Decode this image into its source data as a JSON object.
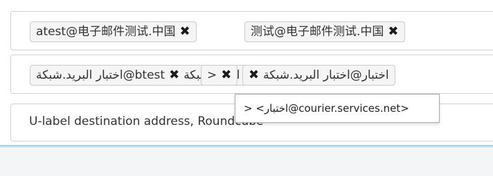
{
  "to_field": {
    "chips": [
      {
        "label": "atest@电子邮件测试.中国",
        "remove": "✖"
      },
      {
        "label": "测试@电子邮件测试.中国",
        "remove": "✖"
      }
    ]
  },
  "cc_field": {
    "chips": [
      {
        "label": "btest@اختبار البريد.شبكة",
        "remove": "✖"
      },
      {
        "label": "اختبار البريد.شبكة",
        "remove": "✖"
      },
      {
        "label": ">",
        "remove": "✖"
      },
      {
        "label": "اختبار@اختبار البريد.شبكة",
        "remove": "✖"
      }
    ]
  },
  "tooltip": {
    "text": "> <اختبار@courier.services.net>"
  },
  "subject": {
    "value": "U-label destination address, Roundcube"
  }
}
